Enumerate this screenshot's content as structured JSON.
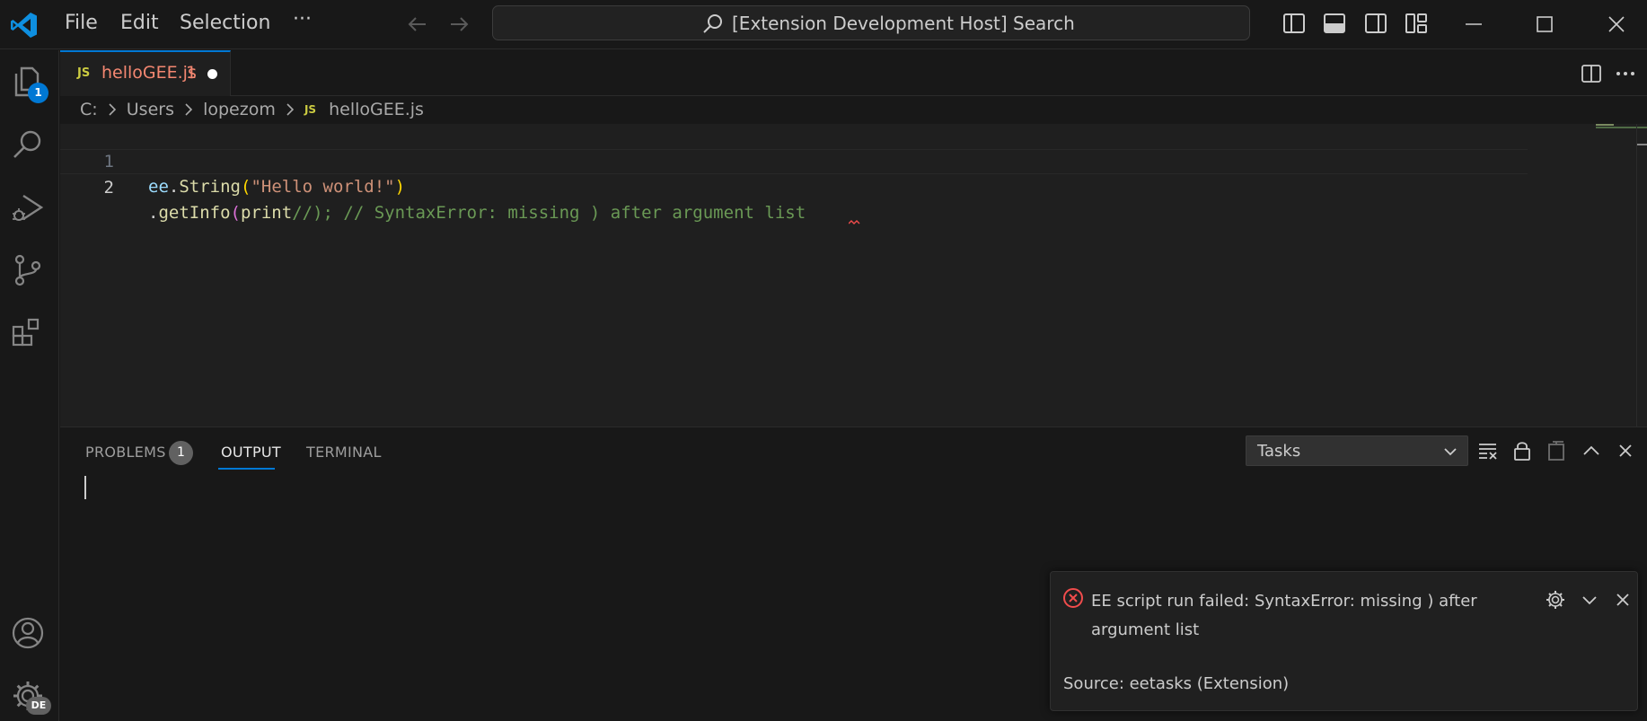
{
  "titlebar": {
    "menu": [
      "File",
      "Edit",
      "Selection"
    ],
    "more": "···",
    "search_text": "[Extension Development Host] Search"
  },
  "activitybar": {
    "explorer_badge": "1",
    "account_badge": "DE"
  },
  "tab": {
    "lang": "JS",
    "filename": "helloGEE.js",
    "problem_count": "1"
  },
  "breadcrumb": {
    "parts": [
      "C:",
      "Users",
      "lopezom"
    ],
    "file_lang": "JS",
    "file": "helloGEE.js"
  },
  "editor": {
    "lines": [
      {
        "number": "1",
        "tokens": [
          {
            "text": "ee",
            "cls": "t-var"
          },
          {
            "text": ".",
            "cls": "t-plain"
          },
          {
            "text": "String",
            "cls": "t-fn"
          },
          {
            "text": "(",
            "cls": "t-p1"
          },
          {
            "text": "\"Hello world!\"",
            "cls": "t-str"
          },
          {
            "text": ")",
            "cls": "t-p1"
          }
        ]
      },
      {
        "number": "2",
        "tokens": [
          {
            "text": ".",
            "cls": "t-plain"
          },
          {
            "text": "getInfo",
            "cls": "t-fn"
          },
          {
            "text": "(",
            "cls": "t-p2"
          },
          {
            "text": "print",
            "cls": "t-fn"
          },
          {
            "text": "//); // SyntaxError: missing ) after argument list",
            "cls": "t-com"
          }
        ]
      }
    ]
  },
  "panel": {
    "tabs": [
      "PROBLEMS",
      "OUTPUT",
      "TERMINAL"
    ],
    "problems_count": "1",
    "active_tab": "OUTPUT",
    "output_channel": "Tasks"
  },
  "notification": {
    "message": "EE script run failed: SyntaxError: missing ) after argument list",
    "source": "Source: eetasks (Extension)"
  },
  "colors": {
    "accent": "#0078d4",
    "error": "#f14c4c",
    "tab_modified": "#f48771"
  }
}
